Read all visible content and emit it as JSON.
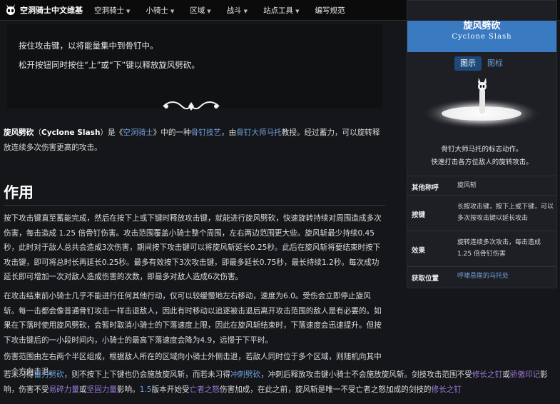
{
  "nav": {
    "site_name": "空洞骑士中文维基",
    "items": [
      "空洞骑士",
      "小骑士",
      "区域",
      "战斗",
      "站点工具",
      "编写规范"
    ]
  },
  "quote": {
    "line1": "按住攻击键，以将能量集中到骨钉中。",
    "line2": "松开按钮同时按住“上”或“下”键以释放旋风劈砍。"
  },
  "intro": {
    "name": "旋风劈砍",
    "p1": "（",
    "en": "Cyclone Slash",
    "p2": "）是《",
    "game": "空洞骑士",
    "p3": "》中的一种",
    "art": "骨钉技艺",
    "p4": "，由",
    "master": "骨钉大师马托",
    "p5": "教授。经过蓄力，可以旋转释放连续多次伤害更高的攻击。"
  },
  "section": {
    "heading": "作用"
  },
  "body": {
    "p1": "按下攻击键直至蓄能完成，然后在按下上或下键时释放攻击键，就能进行旋风劈砍，快速旋转持续对周围造成多次伤害，每击造成 1.25 倍骨钉伤害。攻击范围覆盖小骑士整个周围，左右两边范围更大些。旋风斩最少持续0.45秒，此时对于敌人总共会造成3次伤害，期间按下攻击键可以将旋风斩延长0.25秒。此后在旋风斩将要结束时按下攻击键，即可将总时长再延长0.25秒。最多有效按下3次攻击键，即最多延长0.75秒，最长持续1.2秒。每次成功延长即可增加一次对敌人造成伤害的次数，即最多对敌人造成6次伤害。",
    "p2": "在攻击结束前小骑士几乎不能进行任何其他行动，仅可以较缓慢地左右移动，速度为6.0。受伤会立即停止旋风斩。每一击都会像普通骨钉攻击一样击退敌人，因此有时移动以追逐被击退后离开攻击范围的敌人是有必要的。如果在下落时使用旋风劈砍，会暂时取消小骑士的下落速度上限，因此在旋风斩结束时，下落速度会迅速提升。但按下攻击键后的一小段时间内，小骑士的最高下落速度会降为4.9，远慢于下平时。",
    "p3": "伤害范围由左右两个半区组成，根据敌人所在的区域向小骑士外侧击退，若敌人同时位于多个区域，则随机向其中一个方向击退。",
    "p4a": "若未习得",
    "p4b": "蓄力劈砍",
    "p4c": "，则不按下上下键也仍会施放旋风斩，而若未习得",
    "p4d": "冲刺劈砍",
    "p4e": "，冲刺后释放攻击键小骑士不会施放旋风斩。剑技攻击范围不受",
    "p4f": "修长之钉",
    "p4g": "或",
    "p4h": "骄傲印记",
    "p4i": "影响，伤害不受",
    "p4j": "易碎力量",
    "p4k": "或",
    "p4l": "坚固力量",
    "p4m": "影响。",
    "p4n": "1.5",
    "p4o": "版本开始受",
    "p4p": "亡者之怒",
    "p4q": "伤害加成，在此之前，旋风斩是唯一不受亡者之怒加成的剑技的",
    "p4r": "修长之钉"
  },
  "infobox": {
    "title": "旋风劈砍",
    "subtitle": "Cyclone Slash",
    "tab_active": "图示",
    "tab_other": "图标",
    "caption1": "骨钉大师马托的标志动作。",
    "caption2": "快速打击各方位敌人的旋转攻击。",
    "rows": [
      {
        "key": "其他称呼",
        "value": "旋风斩"
      },
      {
        "key": "按键",
        "value": "长按攻击键，按下上或下键，可以多次按攻击键以延长攻击"
      },
      {
        "key": "效果",
        "value": "旋转连续多次攻击，每击造成 1.25 倍骨钉伤害"
      },
      {
        "key": "获取位置",
        "value": "呼啸悬崖的马托处"
      }
    ]
  },
  "colors": {
    "link": "#6f9fd8",
    "accent": "#3a7ac0",
    "background": "#15161a"
  }
}
